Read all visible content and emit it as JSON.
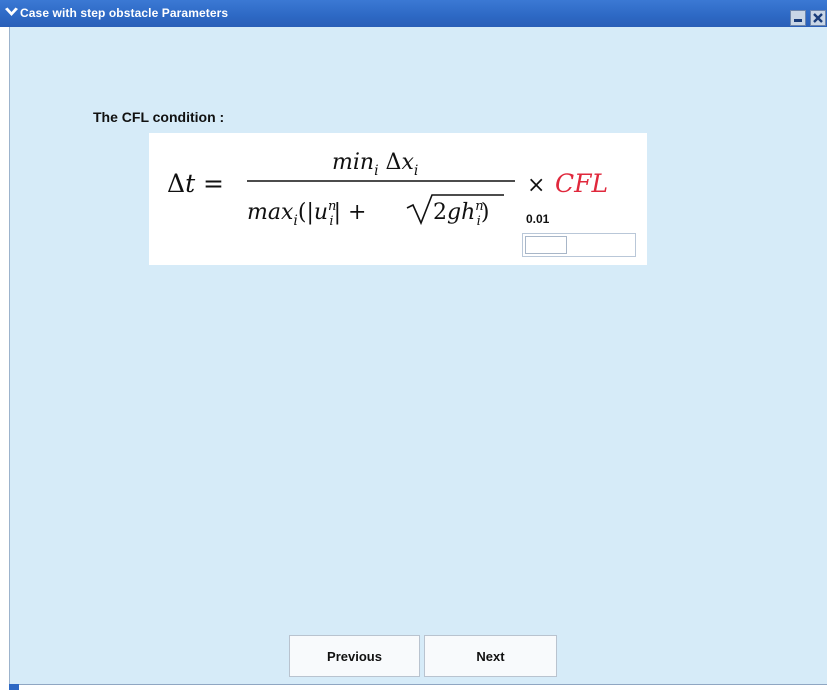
{
  "window": {
    "title": "Case with step obstacle Parameters",
    "menu_icon": "chevron-down-icon",
    "minimize_icon": "minimize-icon",
    "close_icon": "close-icon"
  },
  "main": {
    "cfl_label": "The CFL condition :",
    "formula": {
      "lhs": "Δt =",
      "numerator": "min_i Δx_i",
      "denominator": "max_i(|u_i^n| + √(2gh_i^n))",
      "times": "×",
      "cfl": "CFL"
    },
    "cfl_value": "0.01",
    "cfl_input": ""
  },
  "buttons": {
    "previous": "Previous",
    "next": "Next"
  },
  "colors": {
    "titlebar": "#2d68c4",
    "background": "#d6ebf8",
    "cfl_red": "#e0283c"
  }
}
